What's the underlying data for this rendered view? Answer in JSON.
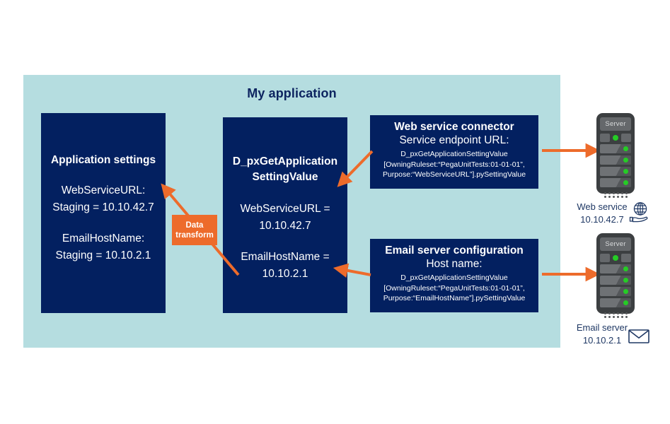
{
  "diagram": {
    "title": "My application",
    "background_color": "#b5dde0",
    "box_color": "#032060",
    "accent_color": "#ed6b2b",
    "caption_color": "#1f3864"
  },
  "app_settings_box": {
    "title": "Application settings",
    "setting_1_name": "WebServiceURL:",
    "setting_1_value": "Staging = 10.10.42.7",
    "setting_2_name": "EmailHostName:",
    "setting_2_value": "Staging = 10.10.2.1"
  },
  "data_page_box": {
    "title_line_1": "D_pxGetApplication",
    "title_line_2": "SettingValue",
    "value_1_name": "WebServiceURL =",
    "value_1_value": "10.10.42.7",
    "value_2_name": "EmailHostName =",
    "value_2_value": "10.10.2.1"
  },
  "data_transform": {
    "label_line_1": "Data",
    "label_line_2": "transform"
  },
  "web_connector_box": {
    "title": "Web service connector",
    "subtitle": "Service endpoint URL:",
    "code_line_1": "D_pxGetApplicationSettingValue",
    "code_line_2": "[OwningRuleset:“PegaUnitTests:01-01-01”,",
    "code_line_3": "Purpose:“WebServiceURL”].pySettingValue"
  },
  "email_config_box": {
    "title": "Email server configuration",
    "subtitle": "Host name:",
    "code_line_1": "D_pxGetApplicationSettingValue",
    "code_line_2": "[OwningRuleset:“PegaUnitTests:01-01-01”,",
    "code_line_3": "Purpose:“EmailHostName”].pySettingValue"
  },
  "web_server": {
    "chassis_label": "Server",
    "caption_line_1": "Web service",
    "caption_line_2": "10.10.42.7"
  },
  "email_server": {
    "chassis_label": "Server",
    "caption_line_1": "Email server",
    "caption_line_2": "10.10.2.1"
  }
}
